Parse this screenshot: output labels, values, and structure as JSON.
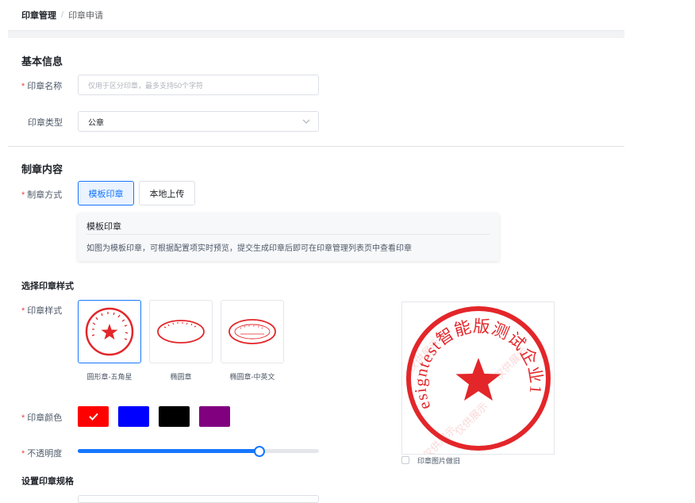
{
  "breadcrumb": {
    "root": "印章管理",
    "separator": "/",
    "current": "印章申请"
  },
  "basic_info": {
    "title": "基本信息",
    "name_field": {
      "label": "印章名称",
      "placeholder": "仅用于区分印章，最多支持50个字符",
      "value": ""
    },
    "type_field": {
      "label": "印章类型",
      "value": "公章"
    }
  },
  "content": {
    "title": "制章内容",
    "method_label": "制章方式",
    "method_options": [
      "模板印章",
      "本地上传"
    ],
    "selected_method": "模板印章",
    "tip": {
      "title": "模板印章",
      "text": "如图为模板印章，可根据配置项实时预览，提交生成印章后即可在印章管理列表页中查看印章"
    }
  },
  "style_section": {
    "title": "选择印章样式",
    "style_label": "印章样式",
    "styles": [
      {
        "name": "圆形章-五角星",
        "icon": "round-seal-star-icon"
      },
      {
        "name": "椭圆章",
        "icon": "oval-seal-icon"
      },
      {
        "name": "椭圆章-中英文",
        "icon": "oval-seal-bilingual-icon"
      }
    ],
    "selected_style": "圆形章-五角星",
    "color_label": "印章颜色",
    "colors": [
      "#ff0000",
      "#0000ff",
      "#000000",
      "#800080"
    ],
    "selected_color": "#ff0000",
    "opacity_label": "不透明度",
    "opacity_value": 0.75
  },
  "preview": {
    "seal_text": "esigntest智能版测试企业1",
    "watermark": "仅供展示",
    "old_checkbox_label": "印章图片做旧",
    "old_checked": false,
    "seal_color": "#e3262a"
  },
  "spec_section": {
    "title": "设置印章规格"
  }
}
